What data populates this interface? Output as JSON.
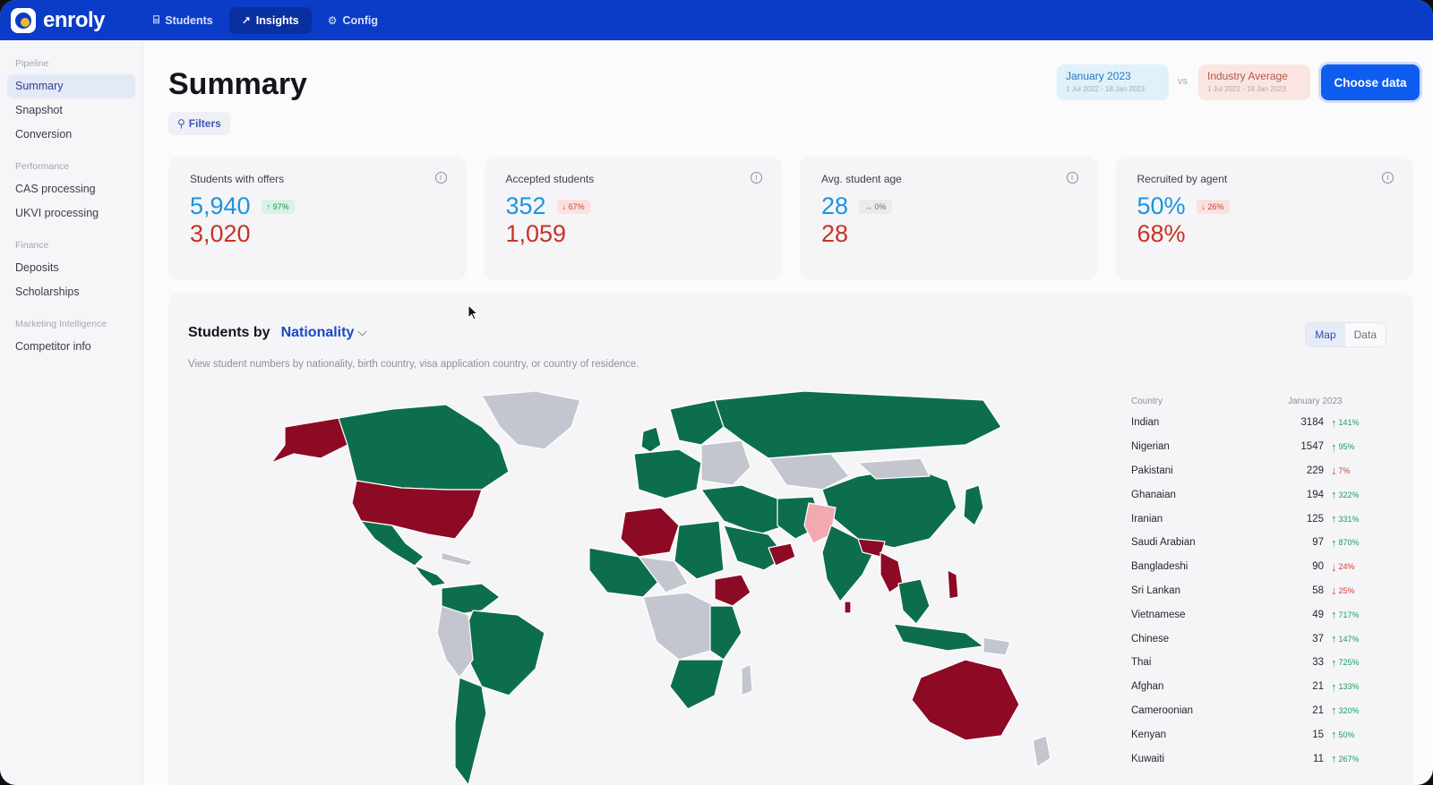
{
  "app": {
    "name": "enroly"
  },
  "nav": [
    {
      "label": "Students",
      "icon": "students-icon",
      "glyph": "⌸",
      "active": false
    },
    {
      "label": "Insights",
      "icon": "chart-icon",
      "glyph": "↗",
      "active": true
    },
    {
      "label": "Config",
      "icon": "gear-icon",
      "glyph": "⚙",
      "active": false
    }
  ],
  "sidebar": [
    {
      "heading": "Pipeline",
      "items": [
        {
          "label": "Summary",
          "active": true
        },
        {
          "label": "Snapshot",
          "active": false
        },
        {
          "label": "Conversion",
          "active": false
        }
      ]
    },
    {
      "heading": "Performance",
      "items": [
        {
          "label": "CAS processing",
          "active": false
        },
        {
          "label": "UKVI processing",
          "active": false
        }
      ]
    },
    {
      "heading": "Finance",
      "items": [
        {
          "label": "Deposits",
          "active": false
        },
        {
          "label": "Scholarships",
          "active": false
        }
      ]
    },
    {
      "heading": "Marketing Intelligence",
      "items": [
        {
          "label": "Competitor info",
          "active": false
        }
      ]
    }
  ],
  "page": {
    "title": "Summary",
    "filters_label": "Filters",
    "period_a": {
      "title": "January 2023",
      "range": "1 Jul 2022 - 18 Jan 2023"
    },
    "vs": "vs",
    "period_b": {
      "title": "Industry Average",
      "range": "1 Jul 2022 - 18 Jan 2023"
    },
    "choose_label": "Choose data"
  },
  "kpis": [
    {
      "label": "Students with offers",
      "primary": "5,940",
      "badge": "↑ 97%",
      "trend": "up",
      "secondary": "3,020"
    },
    {
      "label": "Accepted students",
      "primary": "352",
      "badge": "↓ 67%",
      "trend": "down",
      "secondary": "1,059"
    },
    {
      "label": "Avg. student age",
      "primary": "28",
      "badge": "→ 0%",
      "trend": "flat",
      "secondary": "28"
    },
    {
      "label": "Recruited by agent",
      "primary": "50%",
      "badge": "↓ 26%",
      "trend": "down",
      "secondary": "68%"
    }
  ],
  "panel": {
    "title": "Students by",
    "dimension": "Nationality",
    "description": "View student numbers by nationality, birth country, visa application country, or country of residence.",
    "toggle": [
      {
        "label": "Map",
        "active": true
      },
      {
        "label": "Data",
        "active": false
      }
    ],
    "table": {
      "col_country": "Country",
      "col_value": "January 2023",
      "rows": [
        {
          "country": "Indian",
          "value": "3184",
          "change": "141%",
          "dir": "up"
        },
        {
          "country": "Nigerian",
          "value": "1547",
          "change": "95%",
          "dir": "up"
        },
        {
          "country": "Pakistani",
          "value": "229",
          "change": "7%",
          "dir": "down"
        },
        {
          "country": "Ghanaian",
          "value": "194",
          "change": "322%",
          "dir": "up"
        },
        {
          "country": "Iranian",
          "value": "125",
          "change": "331%",
          "dir": "up"
        },
        {
          "country": "Saudi Arabian",
          "value": "97",
          "change": "870%",
          "dir": "up"
        },
        {
          "country": "Bangladeshi",
          "value": "90",
          "change": "24%",
          "dir": "down"
        },
        {
          "country": "Sri Lankan",
          "value": "58",
          "change": "25%",
          "dir": "down"
        },
        {
          "country": "Vietnamese",
          "value": "49",
          "change": "717%",
          "dir": "up"
        },
        {
          "country": "Chinese",
          "value": "37",
          "change": "147%",
          "dir": "up"
        },
        {
          "country": "Thai",
          "value": "33",
          "change": "725%",
          "dir": "up"
        },
        {
          "country": "Afghan",
          "value": "21",
          "change": "133%",
          "dir": "up"
        },
        {
          "country": "Cameroonian",
          "value": "21",
          "change": "320%",
          "dir": "up"
        },
        {
          "country": "Kenyan",
          "value": "15",
          "change": "50%",
          "dir": "up"
        },
        {
          "country": "Kuwaiti",
          "value": "11",
          "change": "267%",
          "dir": "up"
        }
      ]
    }
  },
  "colors": {
    "brand": "#0a3cc8",
    "increase": "#0d6e4d",
    "decrease": "#8d0a25",
    "slight_decrease": "#f2a9b0",
    "no_data": "#c4c6cf"
  }
}
